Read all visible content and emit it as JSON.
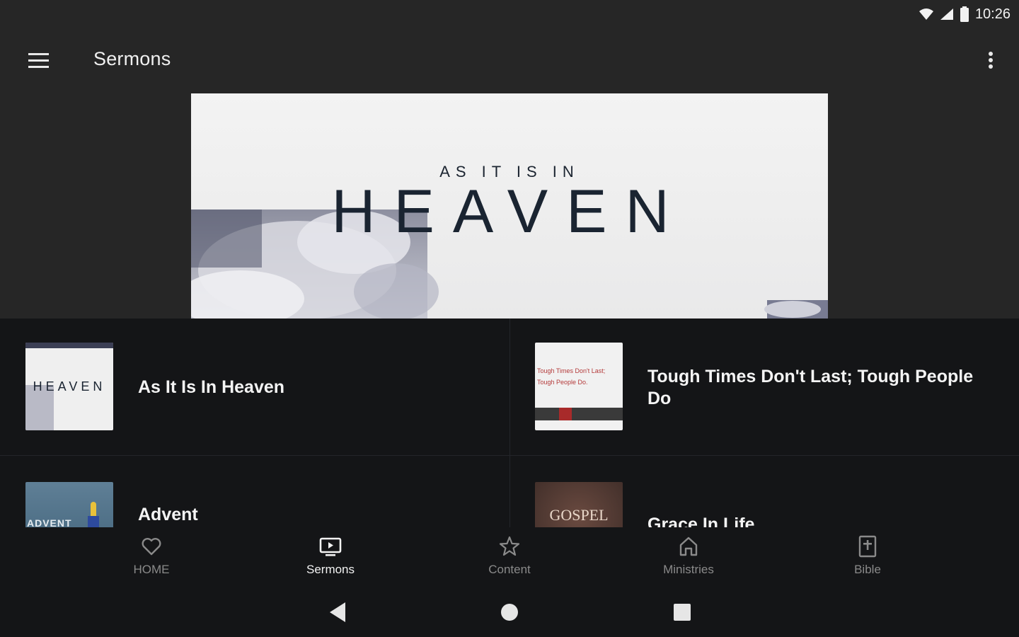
{
  "status_bar": {
    "time": "10:26",
    "icons": [
      "wifi-icon",
      "signal-icon",
      "battery-icon"
    ]
  },
  "app_bar": {
    "title": "Sermons",
    "menu_icon": "hamburger-menu-icon",
    "overflow_icon": "more-vert-icon"
  },
  "banner": {
    "overline": "AS IT IS IN",
    "title": "HEAVEN"
  },
  "sermon_series": [
    {
      "title": "As It Is In Heaven",
      "thumb_text": "HEAVEN"
    },
    {
      "title": "Tough Times Don't Last; Tough People Do",
      "thumb_text": "Tough Times Don't Last; Tough People Do."
    },
    {
      "title": "Advent",
      "thumb_text": "ADVENT"
    },
    {
      "title": "Grace In Life",
      "thumb_text": "GOSPEL"
    }
  ],
  "bottom_nav": [
    {
      "label": "HOME",
      "icon": "heart-icon",
      "active": false
    },
    {
      "label": "Sermons",
      "icon": "tv-play-icon",
      "active": true
    },
    {
      "label": "Content",
      "icon": "star-icon",
      "active": false
    },
    {
      "label": "Ministries",
      "icon": "house-icon",
      "active": false
    },
    {
      "label": "Bible",
      "icon": "bible-icon",
      "active": false
    }
  ],
  "system_nav": [
    "back-icon",
    "home-icon",
    "recents-icon"
  ],
  "colors": {
    "bar_bg": "#262626",
    "content_bg": "#141517",
    "text_primary": "#f4f4f4",
    "text_inactive": "#8a8a8a"
  }
}
